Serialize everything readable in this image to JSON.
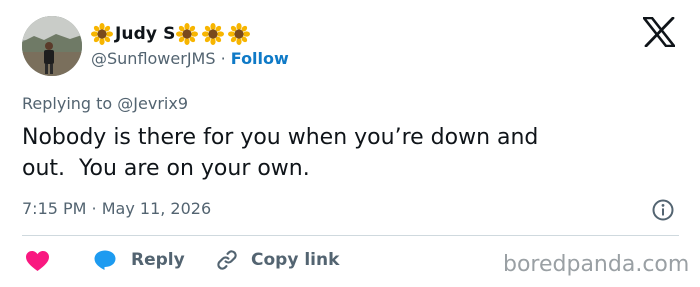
{
  "author": {
    "name": "Judy S",
    "name_suffix_emojis": [
      "sunflower",
      "sunflower",
      "sunflower"
    ],
    "handle": "@SunflowerJMS",
    "separator": "·",
    "follow_label": "Follow"
  },
  "replying_to": "Replying to @Jevrix9",
  "tweet_text": "Nobody is there for you when you’re down and\nout.  You are on your own.",
  "timestamp": "7:15 PM · May 11, 2026",
  "actions": {
    "like_icon": "heart-icon",
    "reply_label": "Reply",
    "reply_icon": "speech-bubble-icon",
    "copy_link_label": "Copy link",
    "copy_link_icon": "link-icon"
  },
  "branding": {
    "platform_logo": "x-logo-icon",
    "info_icon": "info-icon"
  },
  "watermark": "boredpanda.com",
  "colors": {
    "text": "#0f1419",
    "secondary": "#536471",
    "follow": "#0f7ac7",
    "like": "#f91880",
    "reply": "#1d9bf0",
    "divider": "#cfd9de",
    "watermark": "#9aa0a4"
  }
}
